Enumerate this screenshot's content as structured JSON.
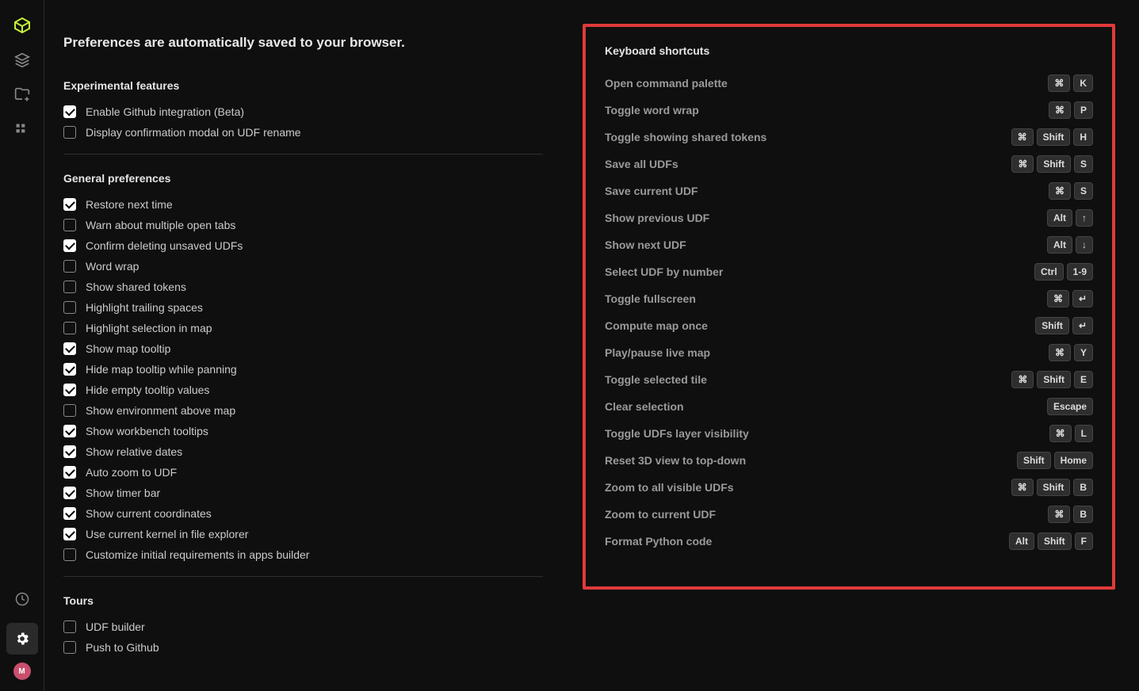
{
  "intro": "Preferences are automatically saved to your browser.",
  "avatar": "M",
  "sections": {
    "experimental": {
      "title": "Experimental features",
      "items": [
        {
          "label": "Enable Github integration (Beta)",
          "checked": true
        },
        {
          "label": "Display confirmation modal on UDF rename",
          "checked": false
        }
      ]
    },
    "general": {
      "title": "General preferences",
      "items": [
        {
          "label": "Restore next time",
          "checked": true
        },
        {
          "label": "Warn about multiple open tabs",
          "checked": false
        },
        {
          "label": "Confirm deleting unsaved UDFs",
          "checked": true
        },
        {
          "label": "Word wrap",
          "checked": false
        },
        {
          "label": "Show shared tokens",
          "checked": false
        },
        {
          "label": "Highlight trailing spaces",
          "checked": false
        },
        {
          "label": "Highlight selection in map",
          "checked": false
        },
        {
          "label": "Show map tooltip",
          "checked": true
        },
        {
          "label": "Hide map tooltip while panning",
          "checked": true
        },
        {
          "label": "Hide empty tooltip values",
          "checked": true
        },
        {
          "label": "Show environment above map",
          "checked": false
        },
        {
          "label": "Show workbench tooltips",
          "checked": true
        },
        {
          "label": "Show relative dates",
          "checked": true
        },
        {
          "label": "Auto zoom to UDF",
          "checked": true
        },
        {
          "label": "Show timer bar",
          "checked": true
        },
        {
          "label": "Show current coordinates",
          "checked": true
        },
        {
          "label": "Use current kernel in file explorer",
          "checked": true
        },
        {
          "label": "Customize initial requirements in apps builder",
          "checked": false
        }
      ]
    },
    "tours": {
      "title": "Tours",
      "items": [
        {
          "label": "UDF builder",
          "checked": false
        },
        {
          "label": "Push to Github",
          "checked": false
        }
      ]
    }
  },
  "shortcuts": {
    "title": "Keyboard shortcuts",
    "items": [
      {
        "label": "Open command palette",
        "keys": [
          "⌘",
          "K"
        ]
      },
      {
        "label": "Toggle word wrap",
        "keys": [
          "⌘",
          "P"
        ]
      },
      {
        "label": "Toggle showing shared tokens",
        "keys": [
          "⌘",
          "Shift",
          "H"
        ]
      },
      {
        "label": "Save all UDFs",
        "keys": [
          "⌘",
          "Shift",
          "S"
        ]
      },
      {
        "label": "Save current UDF",
        "keys": [
          "⌘",
          "S"
        ]
      },
      {
        "label": "Show previous UDF",
        "keys": [
          "Alt",
          "↑"
        ]
      },
      {
        "label": "Show next UDF",
        "keys": [
          "Alt",
          "↓"
        ]
      },
      {
        "label": "Select UDF by number",
        "keys": [
          "Ctrl",
          "1-9"
        ]
      },
      {
        "label": "Toggle fullscreen",
        "keys": [
          "⌘",
          "↵"
        ]
      },
      {
        "label": "Compute map once",
        "keys": [
          "Shift",
          "↵"
        ]
      },
      {
        "label": "Play/pause live map",
        "keys": [
          "⌘",
          "Y"
        ]
      },
      {
        "label": "Toggle selected tile",
        "keys": [
          "⌘",
          "Shift",
          "E"
        ]
      },
      {
        "label": "Clear selection",
        "keys": [
          "Escape"
        ]
      },
      {
        "label": "Toggle UDFs layer visibility",
        "keys": [
          "⌘",
          "L"
        ]
      },
      {
        "label": "Reset 3D view to top-down",
        "keys": [
          "Shift",
          "Home"
        ]
      },
      {
        "label": "Zoom to all visible UDFs",
        "keys": [
          "⌘",
          "Shift",
          "B"
        ]
      },
      {
        "label": "Zoom to current UDF",
        "keys": [
          "⌘",
          "B"
        ]
      },
      {
        "label": "Format Python code",
        "keys": [
          "Alt",
          "Shift",
          "F"
        ]
      }
    ]
  }
}
